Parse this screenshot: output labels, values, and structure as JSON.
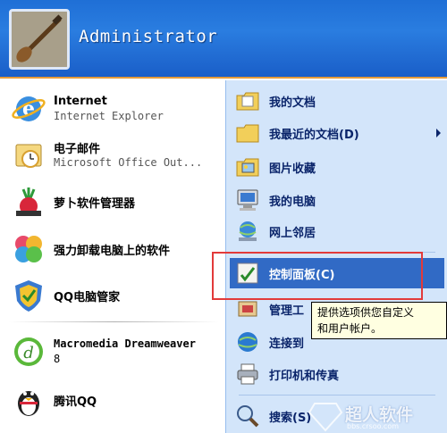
{
  "header": {
    "user_name": "Administrator"
  },
  "left_items": [
    {
      "title": "Internet",
      "subtitle": "Internet Explorer",
      "icon": "internet-explorer-icon"
    },
    {
      "title": "电子邮件",
      "subtitle": "Microsoft Office Out...",
      "icon": "outlook-icon"
    },
    {
      "title": "萝卜软件管理器",
      "icon": "radish-icon"
    },
    {
      "title": "强力卸载电脑上的软件",
      "icon": "uninstaller-icon"
    },
    {
      "title": "QQ电脑管家",
      "icon": "qq-manager-shield-icon"
    },
    {
      "title": "Macromedia Dreamweaver",
      "subtitle": "8",
      "icon": "dreamweaver-icon"
    },
    {
      "title": "腾讯QQ",
      "icon": "qq-penguin-icon"
    }
  ],
  "right_items": [
    {
      "label": "我的文档",
      "icon": "my-documents-icon"
    },
    {
      "label": "我最近的文档(D)",
      "icon": "recent-documents-icon",
      "submenu": true
    },
    {
      "label": "图片收藏",
      "icon": "pictures-icon"
    },
    {
      "label": "我的电脑",
      "icon": "my-computer-icon"
    },
    {
      "label": "网上邻居",
      "icon": "network-places-icon"
    },
    {
      "label": "控制面板(C)",
      "icon": "control-panel-icon",
      "highlighted": true
    },
    {
      "label": "管理工",
      "icon": "admin-tools-icon"
    },
    {
      "label": "连接到",
      "icon": "connect-to-icon"
    },
    {
      "label": "打印机和传真",
      "icon": "printer-icon"
    },
    {
      "label": "搜索(S)",
      "icon": "search-icon"
    }
  ],
  "tooltip": {
    "line1": "提供选项供您自定义",
    "line2": "和用户帐户。"
  },
  "watermark": {
    "text": "超人软件",
    "url": "bbs.crsoo.com"
  },
  "colors": {
    "header_blue": "#1f6fd6",
    "right_panel": "#d3e5fa",
    "highlight": "#316ac5",
    "annotation_red": "#e23a3a"
  }
}
